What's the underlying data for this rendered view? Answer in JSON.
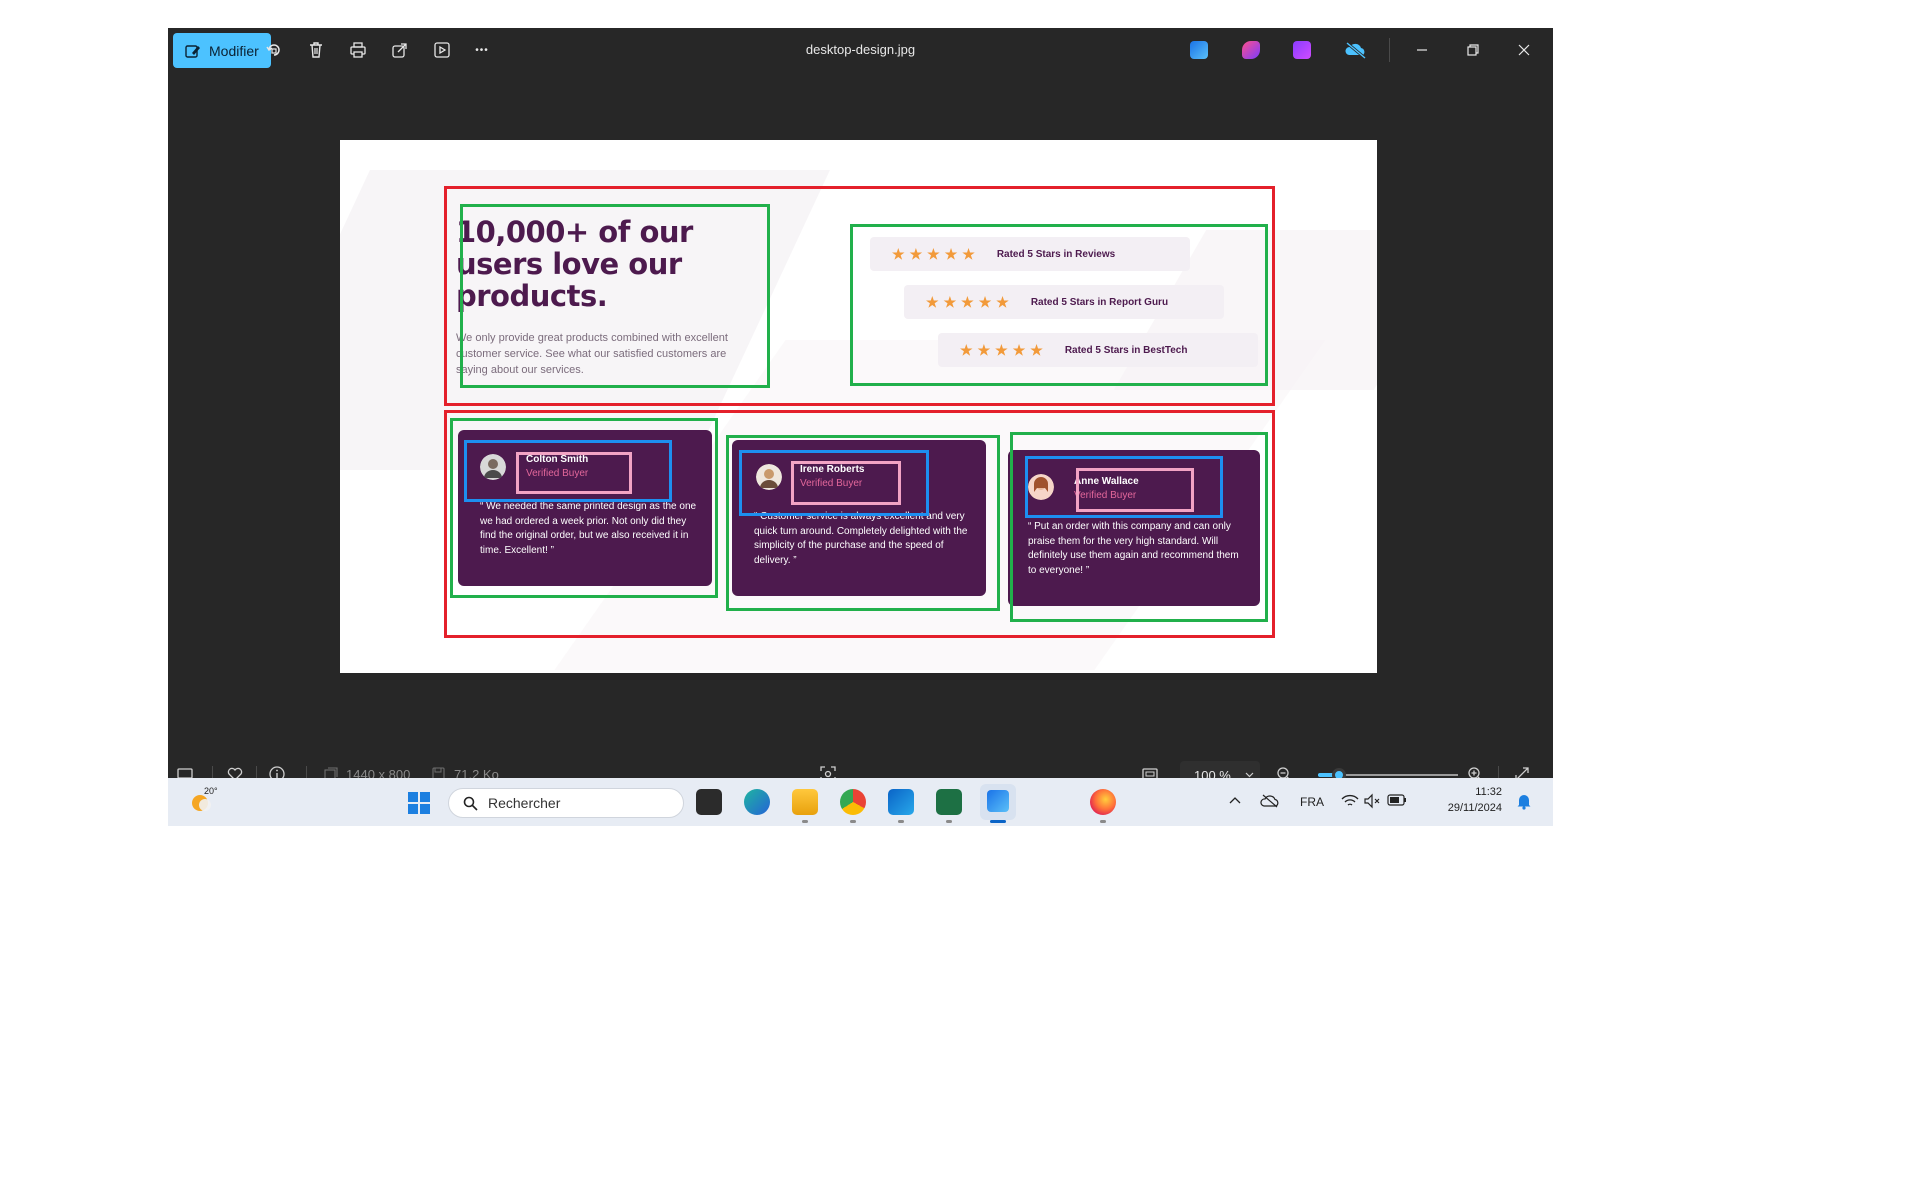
{
  "window": {
    "title": "desktop-design.jpg",
    "edit_button_label": "Modifier",
    "toolbar_icons": [
      "rotate-icon",
      "delete-icon",
      "print-icon",
      "share-icon",
      "slideshow-icon",
      "more-icon"
    ],
    "more_label": "•••"
  },
  "design": {
    "heading": "10,000+ of our users love our products.",
    "intro": "We only provide great products combined with excellent customer service. See what our satisfied customers are saying about our services.",
    "star_glyph": "★",
    "ratings": [
      {
        "stars": 5,
        "label": "Rated 5 Stars in Reviews"
      },
      {
        "stars": 5,
        "label": "Rated 5 Stars in Report Guru"
      },
      {
        "stars": 5,
        "label": "Rated 5 Stars in BestTech"
      }
    ],
    "testimonials": [
      {
        "name": "Colton Smith",
        "role": "Verified Buyer",
        "quote": "“ We needed the same printed design as the one we had ordered a week prior. Not only did they find the original order, but we also received it in time. Excellent! ”"
      },
      {
        "name": "Irene Roberts",
        "role": "Verified Buyer",
        "quote": "“ Customer service is always excellent and very quick turn around. Completely delighted with the simplicity of the purchase and the speed of delivery. ”"
      },
      {
        "name": "Anne Wallace",
        "role": "Verified Buyer",
        "quote": "“ Put an order with this company and can only praise them for the very high standard. Will definitely use them again and recommend them to everyone! ”"
      }
    ]
  },
  "statusbar": {
    "dimensions": "1440 x 800",
    "file_size": "71.2 Ko",
    "zoom": "100 %",
    "zoom_level_percent": 100
  },
  "taskbar": {
    "weather_temp": "20°",
    "search_placeholder": "Rechercher",
    "language": "FRA",
    "time": "11:32",
    "date": "29/11/2024"
  },
  "colors": {
    "accent": "#4cc2ff",
    "card_bg": "#4d1a4e",
    "star": "#f29a3a",
    "buyer": "#e3679b",
    "annotation_red": "#e4202b",
    "annotation_green": "#21b04b",
    "annotation_blue": "#1d8ff0",
    "annotation_pink": "#f2a3c4"
  }
}
